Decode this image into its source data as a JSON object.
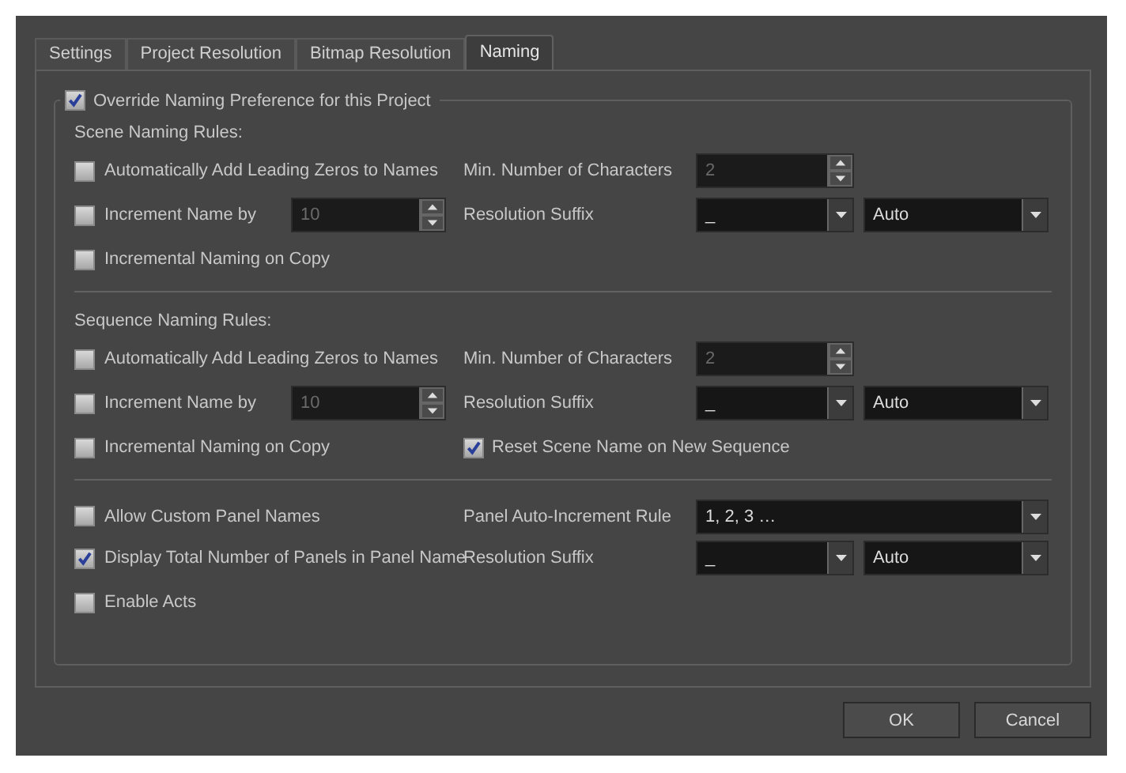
{
  "tabs": [
    {
      "label": "Settings",
      "selected": false
    },
    {
      "label": "Project Resolution",
      "selected": false
    },
    {
      "label": "Bitmap Resolution",
      "selected": false
    },
    {
      "label": "Naming",
      "selected": true
    }
  ],
  "override": {
    "label": "Override Naming Preference for this Project",
    "checked": true
  },
  "sections": [
    {
      "title": "Scene Naming Rules:",
      "rows": [
        {
          "left": {
            "label": "Automatically Add Leading Zeros to Names",
            "checked": false
          },
          "right": {
            "kind": "spin",
            "label": "Min. Number of Characters",
            "value": "2"
          }
        },
        {
          "left": {
            "label": "Increment Name by",
            "checked": false,
            "spin": "10"
          },
          "right": {
            "kind": "suffix",
            "label": "Resolution Suffix",
            "values": [
              "_",
              "Auto"
            ]
          }
        },
        {
          "left": {
            "label": "Incremental Naming on Copy",
            "checked": false
          }
        }
      ]
    },
    {
      "title": "Sequence Naming Rules:",
      "rows": [
        {
          "left": {
            "label": "Automatically Add Leading Zeros to Names",
            "checked": false
          },
          "right": {
            "kind": "spin",
            "label": "Min. Number of Characters",
            "value": "2"
          }
        },
        {
          "left": {
            "label": "Increment Name by",
            "checked": false,
            "spin": "10"
          },
          "right": {
            "kind": "suffix",
            "label": "Resolution Suffix",
            "values": [
              "_",
              "Auto"
            ]
          }
        },
        {
          "left": {
            "label": "Incremental Naming on Copy",
            "checked": false
          },
          "right": {
            "kind": "check",
            "label": "Reset Scene Name on New Sequence",
            "checked": true
          }
        }
      ]
    },
    {
      "rows": [
        {
          "left": {
            "label": "Allow Custom Panel Names",
            "checked": false
          },
          "right": {
            "kind": "combo",
            "label": "Panel Auto-Increment Rule",
            "value": "1, 2, 3 …"
          }
        },
        {
          "left": {
            "label": "Display Total Number of Panels in Panel Name",
            "checked": true
          },
          "right": {
            "kind": "suffix",
            "label": "Resolution Suffix",
            "values": [
              "_",
              "Auto"
            ]
          }
        },
        {
          "left": {
            "label": "Enable Acts",
            "checked": false
          }
        }
      ]
    }
  ],
  "buttons": [
    "OK",
    "Cancel"
  ]
}
